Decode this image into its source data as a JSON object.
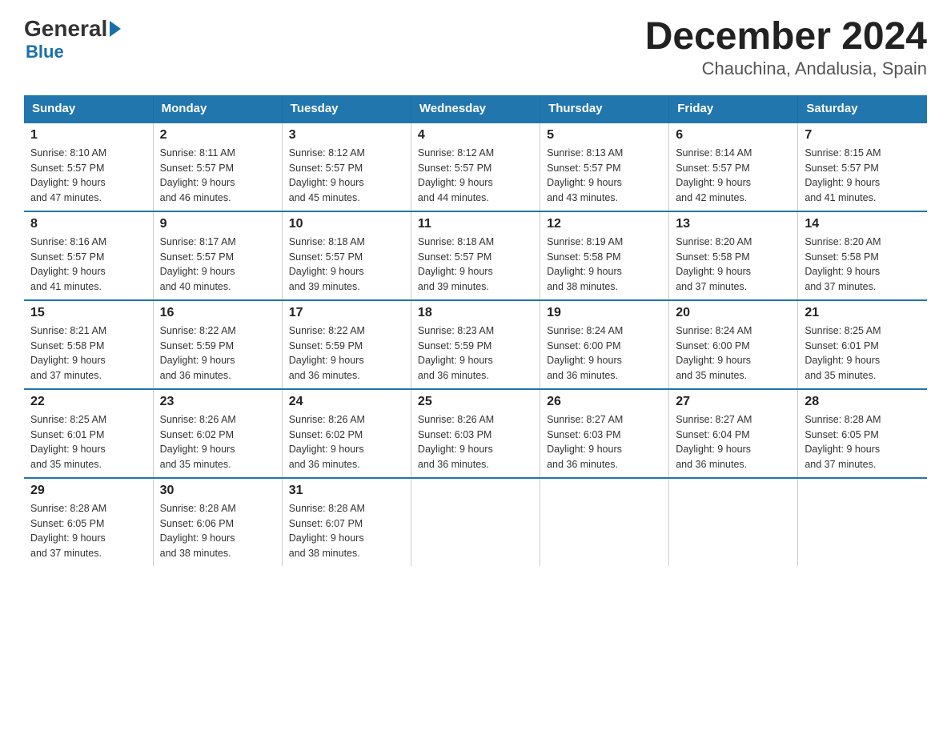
{
  "logo": {
    "general_text": "General",
    "blue_text": "Blue"
  },
  "title": "December 2024",
  "subtitle": "Chauchina, Andalusia, Spain",
  "days_of_week": [
    "Sunday",
    "Monday",
    "Tuesday",
    "Wednesday",
    "Thursday",
    "Friday",
    "Saturday"
  ],
  "weeks": [
    [
      {
        "num": "1",
        "sunrise": "8:10 AM",
        "sunset": "5:57 PM",
        "daylight": "9 hours and 47 minutes."
      },
      {
        "num": "2",
        "sunrise": "8:11 AM",
        "sunset": "5:57 PM",
        "daylight": "9 hours and 46 minutes."
      },
      {
        "num": "3",
        "sunrise": "8:12 AM",
        "sunset": "5:57 PM",
        "daylight": "9 hours and 45 minutes."
      },
      {
        "num": "4",
        "sunrise": "8:12 AM",
        "sunset": "5:57 PM",
        "daylight": "9 hours and 44 minutes."
      },
      {
        "num": "5",
        "sunrise": "8:13 AM",
        "sunset": "5:57 PM",
        "daylight": "9 hours and 43 minutes."
      },
      {
        "num": "6",
        "sunrise": "8:14 AM",
        "sunset": "5:57 PM",
        "daylight": "9 hours and 42 minutes."
      },
      {
        "num": "7",
        "sunrise": "8:15 AM",
        "sunset": "5:57 PM",
        "daylight": "9 hours and 41 minutes."
      }
    ],
    [
      {
        "num": "8",
        "sunrise": "8:16 AM",
        "sunset": "5:57 PM",
        "daylight": "9 hours and 41 minutes."
      },
      {
        "num": "9",
        "sunrise": "8:17 AM",
        "sunset": "5:57 PM",
        "daylight": "9 hours and 40 minutes."
      },
      {
        "num": "10",
        "sunrise": "8:18 AM",
        "sunset": "5:57 PM",
        "daylight": "9 hours and 39 minutes."
      },
      {
        "num": "11",
        "sunrise": "8:18 AM",
        "sunset": "5:57 PM",
        "daylight": "9 hours and 39 minutes."
      },
      {
        "num": "12",
        "sunrise": "8:19 AM",
        "sunset": "5:58 PM",
        "daylight": "9 hours and 38 minutes."
      },
      {
        "num": "13",
        "sunrise": "8:20 AM",
        "sunset": "5:58 PM",
        "daylight": "9 hours and 37 minutes."
      },
      {
        "num": "14",
        "sunrise": "8:20 AM",
        "sunset": "5:58 PM",
        "daylight": "9 hours and 37 minutes."
      }
    ],
    [
      {
        "num": "15",
        "sunrise": "8:21 AM",
        "sunset": "5:58 PM",
        "daylight": "9 hours and 37 minutes."
      },
      {
        "num": "16",
        "sunrise": "8:22 AM",
        "sunset": "5:59 PM",
        "daylight": "9 hours and 36 minutes."
      },
      {
        "num": "17",
        "sunrise": "8:22 AM",
        "sunset": "5:59 PM",
        "daylight": "9 hours and 36 minutes."
      },
      {
        "num": "18",
        "sunrise": "8:23 AM",
        "sunset": "5:59 PM",
        "daylight": "9 hours and 36 minutes."
      },
      {
        "num": "19",
        "sunrise": "8:24 AM",
        "sunset": "6:00 PM",
        "daylight": "9 hours and 36 minutes."
      },
      {
        "num": "20",
        "sunrise": "8:24 AM",
        "sunset": "6:00 PM",
        "daylight": "9 hours and 35 minutes."
      },
      {
        "num": "21",
        "sunrise": "8:25 AM",
        "sunset": "6:01 PM",
        "daylight": "9 hours and 35 minutes."
      }
    ],
    [
      {
        "num": "22",
        "sunrise": "8:25 AM",
        "sunset": "6:01 PM",
        "daylight": "9 hours and 35 minutes."
      },
      {
        "num": "23",
        "sunrise": "8:26 AM",
        "sunset": "6:02 PM",
        "daylight": "9 hours and 35 minutes."
      },
      {
        "num": "24",
        "sunrise": "8:26 AM",
        "sunset": "6:02 PM",
        "daylight": "9 hours and 36 minutes."
      },
      {
        "num": "25",
        "sunrise": "8:26 AM",
        "sunset": "6:03 PM",
        "daylight": "9 hours and 36 minutes."
      },
      {
        "num": "26",
        "sunrise": "8:27 AM",
        "sunset": "6:03 PM",
        "daylight": "9 hours and 36 minutes."
      },
      {
        "num": "27",
        "sunrise": "8:27 AM",
        "sunset": "6:04 PM",
        "daylight": "9 hours and 36 minutes."
      },
      {
        "num": "28",
        "sunrise": "8:28 AM",
        "sunset": "6:05 PM",
        "daylight": "9 hours and 37 minutes."
      }
    ],
    [
      {
        "num": "29",
        "sunrise": "8:28 AM",
        "sunset": "6:05 PM",
        "daylight": "9 hours and 37 minutes."
      },
      {
        "num": "30",
        "sunrise": "8:28 AM",
        "sunset": "6:06 PM",
        "daylight": "9 hours and 38 minutes."
      },
      {
        "num": "31",
        "sunrise": "8:28 AM",
        "sunset": "6:07 PM",
        "daylight": "9 hours and 38 minutes."
      },
      null,
      null,
      null,
      null
    ]
  ],
  "labels": {
    "sunrise": "Sunrise:",
    "sunset": "Sunset:",
    "daylight": "Daylight:"
  }
}
